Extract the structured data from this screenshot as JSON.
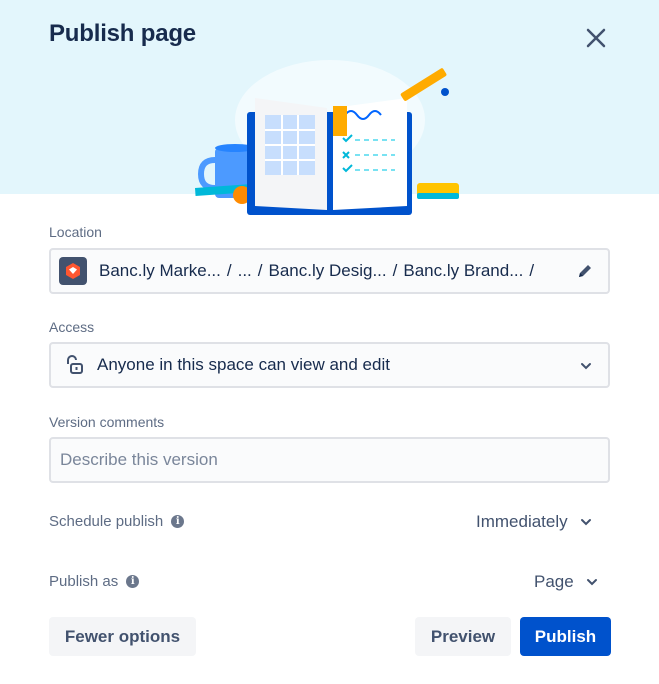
{
  "dialog": {
    "title": "Publish page",
    "close_icon": "close-icon"
  },
  "location": {
    "label": "Location",
    "breadcrumbs": [
      "Banc.ly Marke...",
      "...",
      "Banc.ly Desig...",
      "Banc.ly Brand..."
    ],
    "separator": "/",
    "edit_icon": "pencil-icon"
  },
  "access": {
    "label": "Access",
    "value": "Anyone in this space can view and edit",
    "icon": "unlock-icon"
  },
  "version_comments": {
    "label": "Version comments",
    "placeholder": "Describe this version",
    "value": ""
  },
  "schedule_publish": {
    "label": "Schedule publish",
    "value": "Immediately"
  },
  "publish_as": {
    "label": "Publish as",
    "value": "Page"
  },
  "buttons": {
    "fewer_options": "Fewer options",
    "preview": "Preview",
    "publish": "Publish"
  },
  "colors": {
    "header_bg": "#e3f6fc",
    "primary": "#0052cc",
    "text": "#172b4d",
    "subtle_text": "#5e6c84"
  }
}
